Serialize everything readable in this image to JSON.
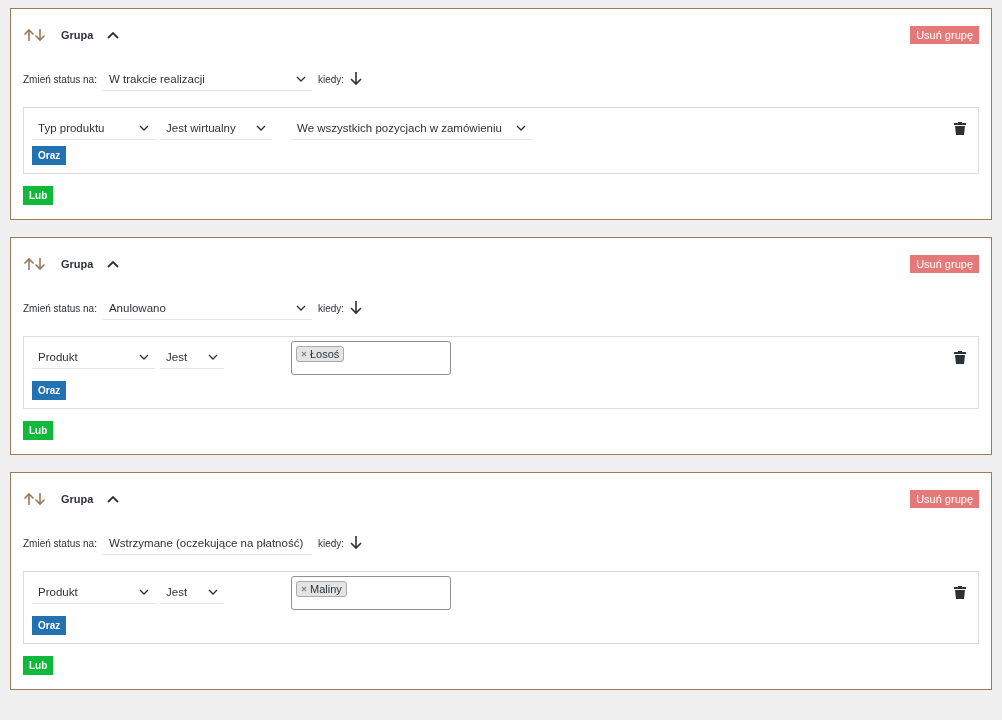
{
  "groups": [
    {
      "title": "Grupa",
      "expanded": true,
      "delete_button": "Usuń grupę",
      "status_label": "Zmień status na:",
      "status_value": "W trakcie realizacji",
      "when_label": "kiedy:",
      "conditions": [
        {
          "kind": "select",
          "fields": [
            "Typ produktu",
            "Jest wirtualny",
            "We wszystkich pozycjach w zamówieniu"
          ]
        }
      ],
      "and_button": "Oraz",
      "or_button": "Lub"
    },
    {
      "title": "Grupa",
      "expanded": true,
      "delete_button": "Usuń grupę",
      "status_label": "Zmień status na:",
      "status_value": "Anulowano",
      "when_label": "kiedy:",
      "conditions": [
        {
          "kind": "tags",
          "fields": [
            "Produkt",
            "Jest"
          ],
          "tags": [
            "Łosoś"
          ]
        }
      ],
      "and_button": "Oraz",
      "or_button": "Lub"
    },
    {
      "title": "Grupa",
      "expanded": true,
      "delete_button": "Usuń grupę",
      "status_label": "Zmień status na:",
      "status_value": "Wstrzymane (oczekujące na płatność)",
      "when_label": "kiedy:",
      "conditions": [
        {
          "kind": "tags",
          "fields": [
            "Produkt",
            "Jest"
          ],
          "tags": [
            "Maliny"
          ]
        }
      ],
      "and_button": "Oraz",
      "or_button": "Lub"
    }
  ]
}
